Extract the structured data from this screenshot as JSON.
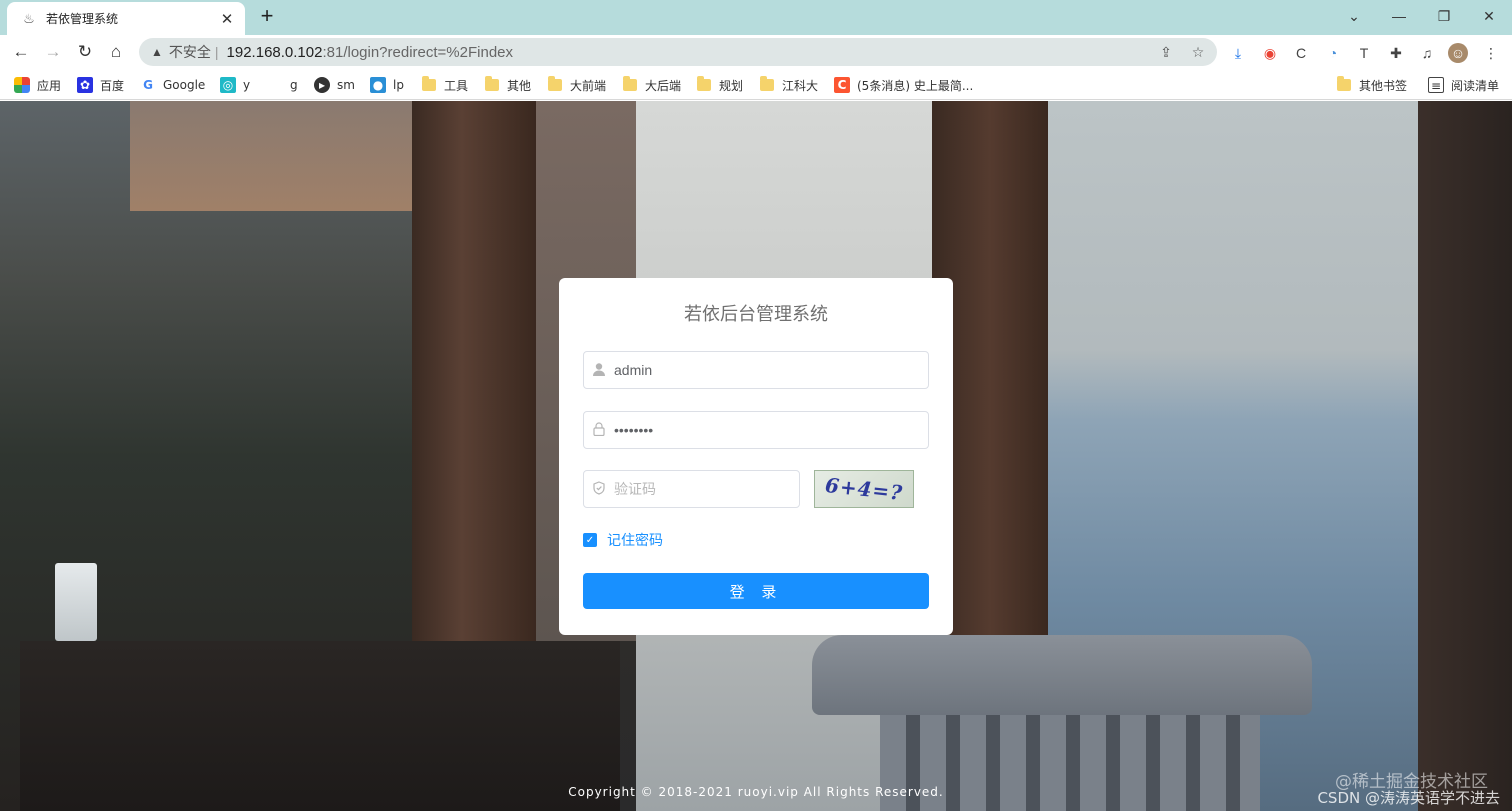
{
  "browser": {
    "tab_title": "若依管理系统",
    "omnibox": {
      "insecure_label": "不安全",
      "host": "192.168.0.102",
      "path": ":81/login?redirect=%2Findex"
    },
    "bookmarks": [
      {
        "label": "应用",
        "icon": "apps-grid-icon"
      },
      {
        "label": "百度",
        "icon": "baidu-paw-icon"
      },
      {
        "label": "Google",
        "icon": "google-g-icon"
      },
      {
        "label": "y",
        "icon": "site-icon"
      },
      {
        "label": "g",
        "icon": "blank-icon"
      },
      {
        "label": "sm",
        "icon": "site-icon"
      },
      {
        "label": "lp",
        "icon": "site-icon"
      },
      {
        "label": "工具",
        "icon": "folder-icon"
      },
      {
        "label": "其他",
        "icon": "folder-icon"
      },
      {
        "label": "大前端",
        "icon": "folder-icon"
      },
      {
        "label": "大后端",
        "icon": "folder-icon"
      },
      {
        "label": "规划",
        "icon": "folder-icon"
      },
      {
        "label": "江科大",
        "icon": "folder-icon"
      },
      {
        "label": "(5条消息) 史上最简...",
        "icon": "csdn-c-icon"
      }
    ],
    "other_bookmarks": "其他书签",
    "reading_list": "阅读清单",
    "colors": {
      "tabstrip": "#b6dcdc",
      "omnibox": "#dfe6e6"
    }
  },
  "login": {
    "title": "若依后台管理系统",
    "username": {
      "value": "admin",
      "icon": "user-icon"
    },
    "password": {
      "value": "••••••••",
      "icon": "lock-icon"
    },
    "code": {
      "placeholder": "验证码",
      "icon": "shield-icon"
    },
    "captcha_text": "6+4=?",
    "remember_label": "记住密码",
    "remember_checked": true,
    "submit_label": "登 录",
    "colors": {
      "primary": "#1890ff",
      "card": "#ffffff"
    }
  },
  "footer": {
    "copyright": "Copyright © 2018-2021 ruoyi.vip All Rights Reserved."
  },
  "watermark": {
    "line1": "@稀土掘金技术社区",
    "line2": "CSDN @涛涛英语学不进去"
  }
}
